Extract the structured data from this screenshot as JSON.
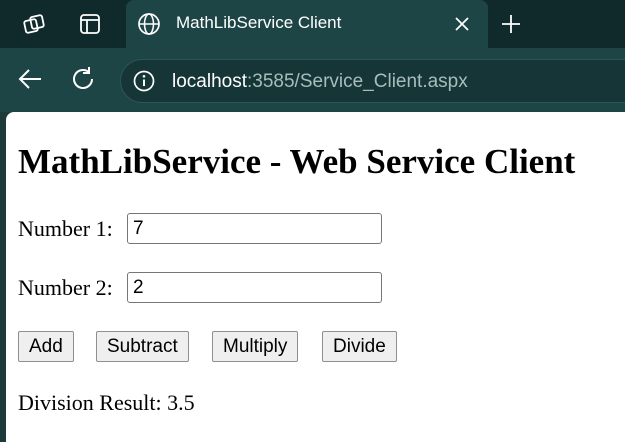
{
  "browser": {
    "tab": {
      "title": "MathLibService Client"
    },
    "address": {
      "host": "localhost",
      "rest": ":3585/Service_Client.aspx"
    }
  },
  "page": {
    "heading": "MathLibService - Web Service Client",
    "number1": {
      "label": "Number 1:",
      "value": "7"
    },
    "number2": {
      "label": "Number 2:",
      "value": "2"
    },
    "buttons": {
      "add": "Add",
      "subtract": "Subtract",
      "multiply": "Multiply",
      "divide": "Divide"
    },
    "result": {
      "label": "Division Result:",
      "value": "3.5"
    }
  },
  "colors": {
    "titlebar": "#102a2b",
    "toolbar": "#1e4546",
    "page_background": "#ffffff"
  },
  "icons": [
    "workspaces-icon",
    "tab-actions-icon",
    "globe-icon",
    "close-icon",
    "plus-icon",
    "back-arrow-icon",
    "refresh-icon",
    "info-icon"
  ]
}
